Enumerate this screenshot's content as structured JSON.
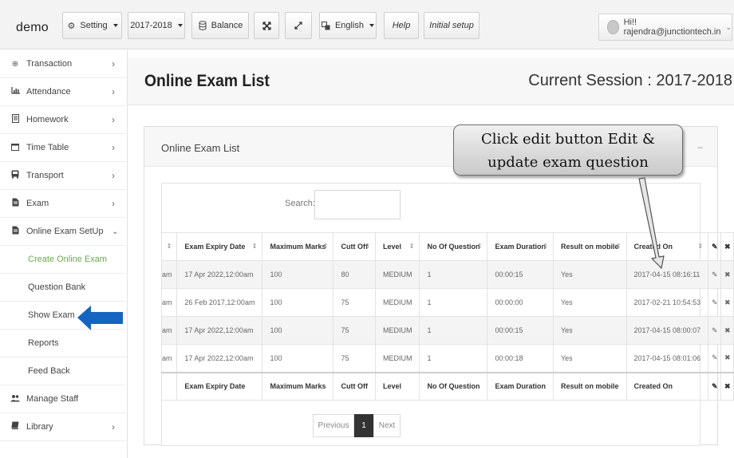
{
  "header": {
    "brand": "demo",
    "setting_label": "Setting",
    "session_label": "2017-2018",
    "balance_label": "Balance",
    "language_label": "English",
    "help_label": "Help",
    "initial_setup_label": "Initial setup",
    "user_label": "Hi!! rajendra@junctiontech.in"
  },
  "sidebar": {
    "items": [
      {
        "label": "Transaction",
        "icon": "globe-icon"
      },
      {
        "label": "Attendance",
        "icon": "bar-chart-icon"
      },
      {
        "label": "Homework",
        "icon": "document-icon"
      },
      {
        "label": "Time Table",
        "icon": "calendar-icon"
      },
      {
        "label": "Transport",
        "icon": "bus-icon"
      },
      {
        "label": "Exam",
        "icon": "file-icon"
      },
      {
        "label": "Online Exam SetUp",
        "icon": "file-icon"
      }
    ],
    "subitems": [
      {
        "label": "Create Online Exam"
      },
      {
        "label": "Question Bank"
      },
      {
        "label": "Show Exam"
      },
      {
        "label": "Reports"
      },
      {
        "label": "Feed Back"
      }
    ],
    "lower_items": [
      {
        "label": "Manage Staff",
        "icon": "users-icon"
      },
      {
        "label": "Library",
        "icon": "book-icon"
      }
    ]
  },
  "page": {
    "title": "Online Exam List",
    "session": "Current Session : 2017-2018"
  },
  "panel": {
    "title": "Online Exam List",
    "minimize": "–"
  },
  "search": {
    "label": "Search:",
    "value": ""
  },
  "table": {
    "headers": [
      "Exam Expiry Date",
      "Maximum Marks",
      "Cutt Off",
      "Level",
      "No Of Question",
      "Exam Duration",
      "Result on mobile",
      "Created On"
    ],
    "rows": [
      [
        "am",
        "17 Apr 2022,12:00am",
        "100",
        "80",
        "MEDIUM",
        "1",
        "00:00:15",
        "Yes",
        "2017-04-15 08:16:11"
      ],
      [
        "am",
        "26 Feb 2017,12:00am",
        "100",
        "75",
        "MEDIUM",
        "1",
        "00:00:00",
        "Yes",
        "2017-02-21 10:54:53"
      ],
      [
        "am",
        "17 Apr 2022,12:00am",
        "100",
        "75",
        "MEDIUM",
        "1",
        "00:00:15",
        "Yes",
        "2017-04-15 08:00:07"
      ],
      [
        "am",
        "17 Apr 2022,12:00am",
        "100",
        "75",
        "MEDIUM",
        "1",
        "00:00:18",
        "Yes",
        "2017-04-15 08:01:06"
      ]
    ],
    "footer": [
      "Exam Expiry Date",
      "Maximum Marks",
      "Cutt Off",
      "Level",
      "No Of Question",
      "Exam Duration",
      "Result on mobile",
      "Created On"
    ]
  },
  "pagination": {
    "previous": "Previous",
    "current": "1",
    "next": "Next"
  },
  "annotation": {
    "line1": "Click edit button Edit &",
    "line2": "update exam question"
  },
  "colors": {
    "active_menu": "#6aa84f",
    "pointer_arrow": "#1565c0"
  }
}
